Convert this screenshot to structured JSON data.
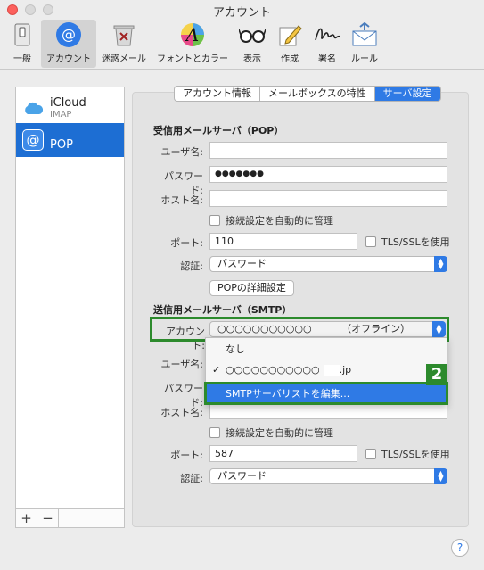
{
  "window": {
    "title": "アカウント"
  },
  "toolbar": {
    "items": [
      {
        "label": "一般",
        "icon": "general-switch-icon"
      },
      {
        "label": "アカウント",
        "icon": "at-sign-icon"
      },
      {
        "label": "迷惑メール",
        "icon": "junk-trash-icon"
      },
      {
        "label": "フォントとカラー",
        "icon": "font-color-icon"
      },
      {
        "label": "表示",
        "icon": "glasses-icon"
      },
      {
        "label": "作成",
        "icon": "compose-pencil-icon"
      },
      {
        "label": "署名",
        "icon": "signature-icon"
      },
      {
        "label": "ルール",
        "icon": "rules-envelope-icon"
      }
    ]
  },
  "sidebar": {
    "accounts": [
      {
        "name": "iCloud",
        "sub": "IMAP"
      },
      {
        "name": "POP",
        "sub": ""
      }
    ],
    "add_label": "+",
    "remove_label": "−"
  },
  "tabs": {
    "account_info": "アカウント情報",
    "mailbox": "メールボックスの特性",
    "server": "サーバ設定"
  },
  "incoming": {
    "title": "受信用メールサーバ（POP）",
    "user_label": "ユーザ名:",
    "user_value": "",
    "password_label": "パスワード:",
    "password_value": "●●●●●●●",
    "host_label": "ホスト名:",
    "host_value": "",
    "auto_manage": "接続設定を自動的に管理",
    "port_label": "ポート:",
    "port_value": "110",
    "tls_label": "TLS/SSLを使用",
    "auth_label": "認証:",
    "auth_value": "パスワード",
    "pop_detail_button": "POPの詳細設定"
  },
  "outgoing": {
    "title": "送信用メールサーバ（SMTP）",
    "account_label": "アカウント:",
    "account_value": "○○○○○○○○○○○",
    "account_status": "（オフライン）",
    "user_label": "ユーザ名:",
    "password_label": "パスワード:",
    "host_label": "ホスト名:",
    "host_value": "",
    "auto_manage": "接続設定を自動的に管理",
    "port_label": "ポート:",
    "port_value": "587",
    "tls_label": "TLS/SSLを使用",
    "auth_label": "認証:",
    "auth_value": "パスワード"
  },
  "dropdown": {
    "none": "なし",
    "server_name": "○○○○○○○○○○○",
    "server_suffix": ".jp",
    "edit_list": "SMTPサーバリストを編集..."
  },
  "badge": "2",
  "help": "?",
  "colors": {
    "accent": "#2f7ae5",
    "highlight": "#2c8a2c",
    "selected": "#1d6ed3"
  }
}
